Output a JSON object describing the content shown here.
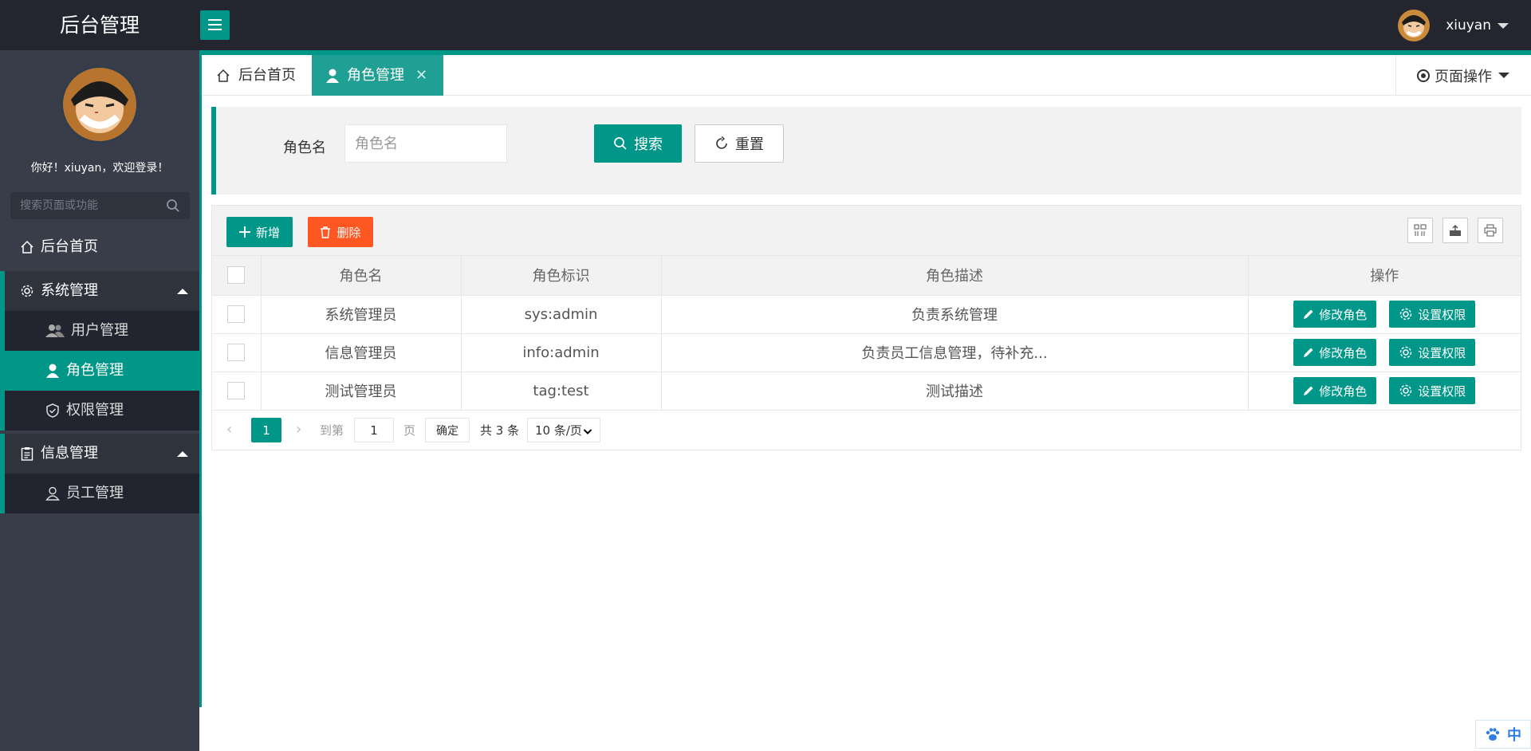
{
  "header": {
    "title": "后台管理",
    "username": "xiuyan"
  },
  "sidebar": {
    "welcome": "你好！xiuyan，欢迎登录！",
    "search_placeholder": "搜索页面或功能",
    "items": [
      {
        "label": "后台首页",
        "icon": "home-icon"
      },
      {
        "label": "系统管理",
        "icon": "gear-icon",
        "expanded": true
      },
      {
        "label": "用户管理",
        "icon": "users-icon"
      },
      {
        "label": "角色管理",
        "icon": "user-icon",
        "active": true
      },
      {
        "label": "权限管理",
        "icon": "shield-icon"
      },
      {
        "label": "信息管理",
        "icon": "clipboard-icon",
        "expanded": true
      },
      {
        "label": "员工管理",
        "icon": "person-icon"
      }
    ]
  },
  "tabs": [
    {
      "label": "后台首页",
      "icon": "home-icon"
    },
    {
      "label": "角色管理",
      "icon": "user-icon",
      "active": true,
      "closable": true
    }
  ],
  "page_ops": {
    "label": "页面操作"
  },
  "search": {
    "label": "角色名",
    "placeholder": "角色名",
    "search_button": "搜索",
    "reset_button": "重置"
  },
  "toolbar": {
    "add_button": "新增",
    "delete_button": "删除"
  },
  "table": {
    "columns": [
      "角色名",
      "角色标识",
      "角色描述",
      "操作"
    ],
    "rows": [
      {
        "name": "系统管理员",
        "key": "sys:admin",
        "desc": "负责系统管理"
      },
      {
        "name": "信息管理员",
        "key": "info:admin",
        "desc": "负责员工信息管理，待补充..."
      },
      {
        "name": "测试管理员",
        "key": "tag:test",
        "desc": "测试描述"
      }
    ],
    "row_actions": {
      "edit": "修改角色",
      "perm": "设置权限"
    }
  },
  "pagination": {
    "current_page": "1",
    "goto_label": "到第",
    "goto_value": "1",
    "page_unit": "页",
    "confirm": "确定",
    "total": "共 3 条",
    "page_size": "10 条/页"
  },
  "lang_badge": "中",
  "colors": {
    "accent": "#009688",
    "danger": "#ff5722",
    "sidebar_bg": "#393d49",
    "header_bg": "#23262e"
  }
}
